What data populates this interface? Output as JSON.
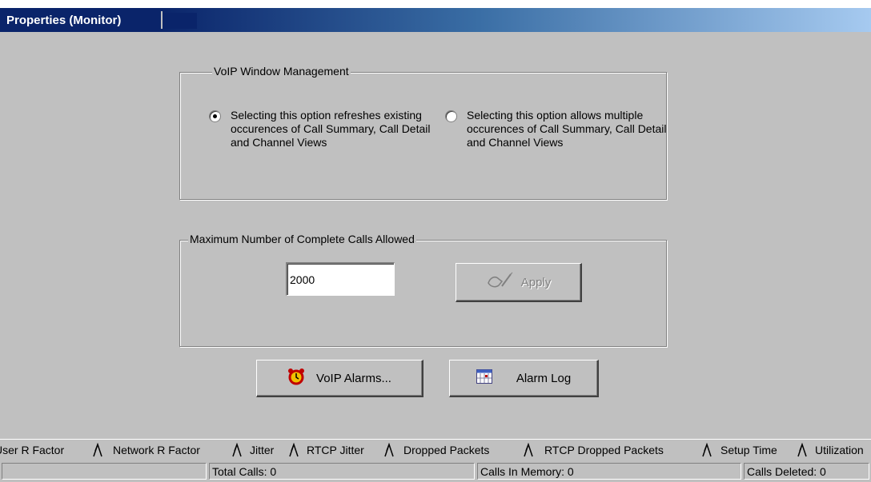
{
  "window": {
    "title": "Properties (Monitor)"
  },
  "voip_window_management": {
    "legend": "VoIP  Window Management",
    "options": [
      {
        "label": "Selecting this option refreshes existing occurences of Call Summary, Call Detail and Channel Views",
        "selected": true
      },
      {
        "label": "Selecting this option allows multiple occurences of Call Summary, Call Detail and Channel Views",
        "selected": false
      }
    ]
  },
  "max_calls": {
    "legend": "Maximum Number of Complete Calls Allowed",
    "value": "2000",
    "apply_label": "Apply",
    "apply_enabled": false
  },
  "actions": {
    "voip_alarms_label": "VoIP Alarms...",
    "alarm_log_label": "Alarm Log"
  },
  "tabs": [
    "User R Factor",
    "Network R Factor",
    "Jitter",
    "RTCP Jitter",
    "Dropped Packets",
    "RTCP Dropped Packets",
    "Setup Time",
    "Utilization"
  ],
  "status": {
    "total_calls": "Total Calls: 0",
    "calls_in_memory": "Calls In Memory: 0",
    "calls_deleted": "Calls Deleted: 0"
  },
  "colors": {
    "title_bar": "#0a246a",
    "face": "#c0c0c0"
  },
  "icons": {
    "apply": "hand-pen-icon",
    "alarms": "alarm-clock-icon",
    "log": "calendar-log-icon",
    "tab_separator": "tab-fork-icon"
  }
}
